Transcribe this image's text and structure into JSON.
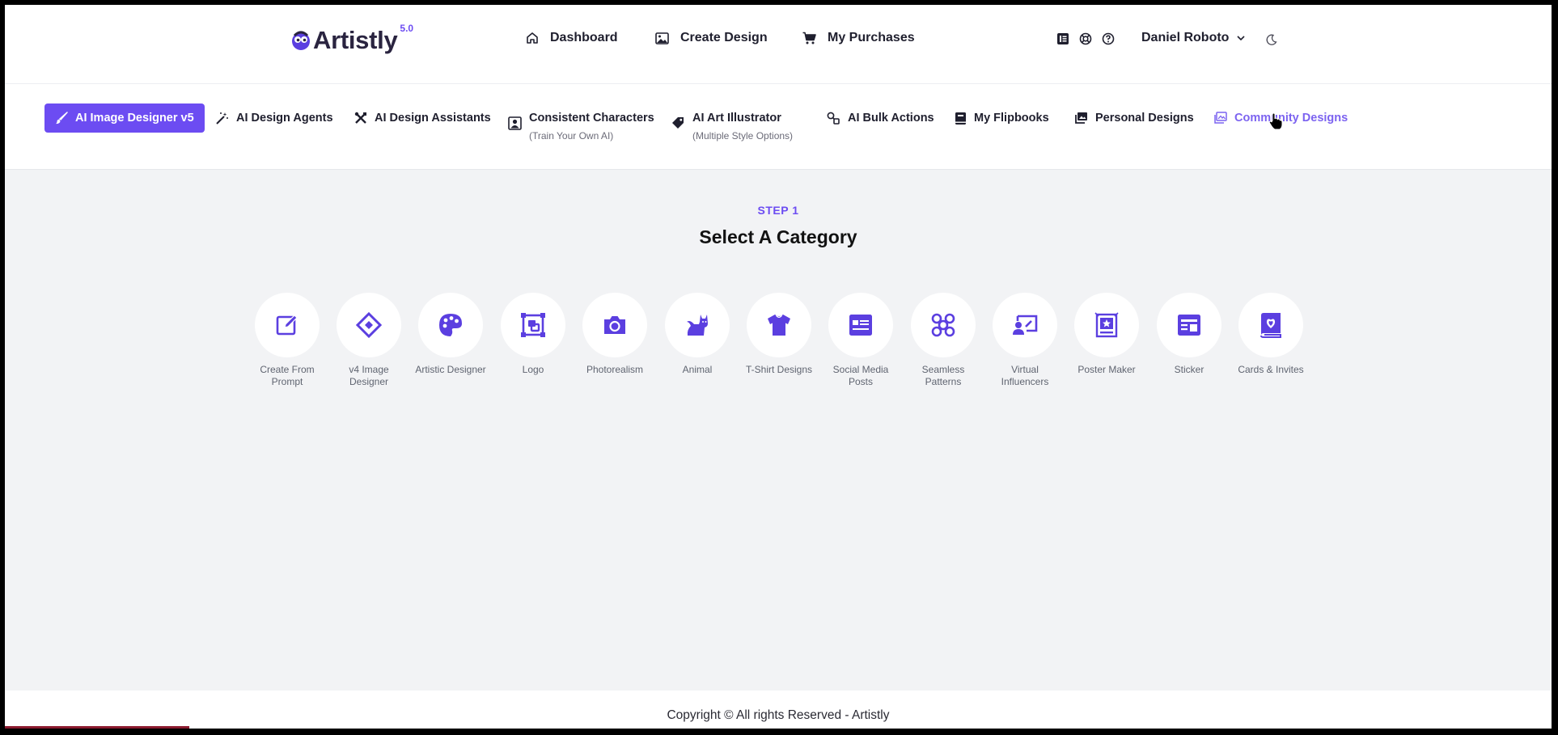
{
  "brand": {
    "name": "Artistly",
    "version": "5.0",
    "color": "#6c4cf2"
  },
  "header": {
    "nav": [
      {
        "label": "Dashboard",
        "icon": "home-icon"
      },
      {
        "label": "Create Design",
        "icon": "image-icon"
      },
      {
        "label": "My Purchases",
        "icon": "cart-icon"
      }
    ],
    "icons": [
      "book-icon",
      "lifebuoy-icon",
      "help-icon"
    ],
    "user_name": "Daniel Roboto",
    "theme_icon": "moon-icon"
  },
  "tools": {
    "tabs": [
      {
        "label": "AI Image Designer v5",
        "icon": "brush-icon",
        "active": true
      },
      {
        "label": "AI Design Agents",
        "icon": "magic-wand-icon"
      },
      {
        "label": "AI Design Assistants",
        "icon": "tools-icon"
      },
      {
        "label": "Consistent Characters",
        "sub": "(Train Your Own AI)",
        "icon": "portrait-icon"
      },
      {
        "label": "AI Art Illustrator",
        "sub": "(Multiple Style Options)",
        "icon": "tag-icon"
      },
      {
        "label": "AI Bulk Actions",
        "icon": "bulk-icon"
      },
      {
        "label": "My Flipbooks",
        "icon": "flipbook-icon"
      },
      {
        "label": "Personal Designs",
        "icon": "gallery-icon"
      },
      {
        "label": "Community Designs",
        "icon": "community-icon"
      }
    ]
  },
  "main": {
    "step_label": "STEP 1",
    "title": "Select A Category",
    "categories": [
      {
        "label": "Create From Prompt",
        "icon": "edit-icon"
      },
      {
        "label": "v4 Image Designer",
        "icon": "diamond-icon"
      },
      {
        "label": "Artistic Designer",
        "icon": "palette-icon"
      },
      {
        "label": "Logo",
        "icon": "logo-icon"
      },
      {
        "label": "Photorealism",
        "icon": "camera-icon"
      },
      {
        "label": "Animal",
        "icon": "cat-icon"
      },
      {
        "label": "T-Shirt Designs",
        "icon": "tshirt-icon"
      },
      {
        "label": "Social Media Posts",
        "icon": "post-icon"
      },
      {
        "label": "Seamless Patterns",
        "icon": "pattern-icon"
      },
      {
        "label": "Virtual Influencers",
        "icon": "influencer-icon"
      },
      {
        "label": "Poster Maker",
        "icon": "poster-icon"
      },
      {
        "label": "Sticker",
        "icon": "sticker-icon"
      },
      {
        "label": "Cards & Invites",
        "icon": "card-icon"
      }
    ]
  },
  "footer": {
    "text": "Copyright © All rights Reserved - Artistly"
  }
}
